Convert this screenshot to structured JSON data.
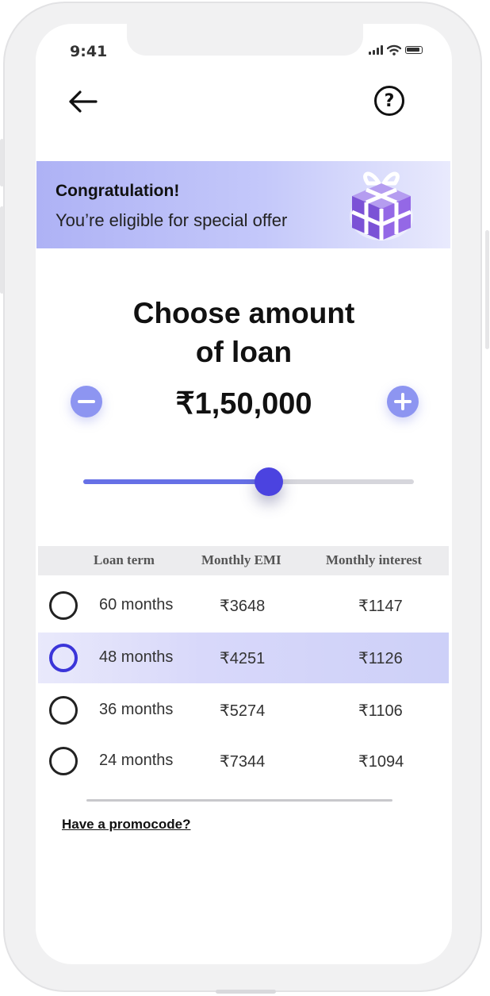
{
  "status_bar": {
    "time": "9:41"
  },
  "nav": {
    "back_icon": "arrow-left-icon",
    "help_icon": "question-circle-icon",
    "help_glyph": "?"
  },
  "banner": {
    "title": "Congratulation!",
    "subtitle": "You’re eligible for special offer",
    "icon": "gift-box-icon"
  },
  "loan": {
    "heading_line1": "Choose amount",
    "heading_line2": "of loan",
    "amount": "₹1,50,000",
    "slider_fraction": 0.56
  },
  "table": {
    "headers": [
      "Loan term",
      "Monthly EMI",
      "Monthly interest"
    ],
    "rows": [
      {
        "term": "60 months",
        "emi": "₹3648",
        "interest": "₹1147",
        "selected": false
      },
      {
        "term": "48 months",
        "emi": "₹4251",
        "interest": "₹1126",
        "selected": true
      },
      {
        "term": "36 months",
        "emi": "₹5274",
        "interest": "₹1106",
        "selected": false
      },
      {
        "term": "24 months",
        "emi": "₹7344",
        "interest": "₹1094",
        "selected": false
      }
    ]
  },
  "promo": {
    "label": "Have a promocode?"
  },
  "colors": {
    "accent": "#4b43e0",
    "accent_light": "#8d95f1",
    "banner": "#aeb2f5",
    "selected_row": "#d8d8fa"
  }
}
